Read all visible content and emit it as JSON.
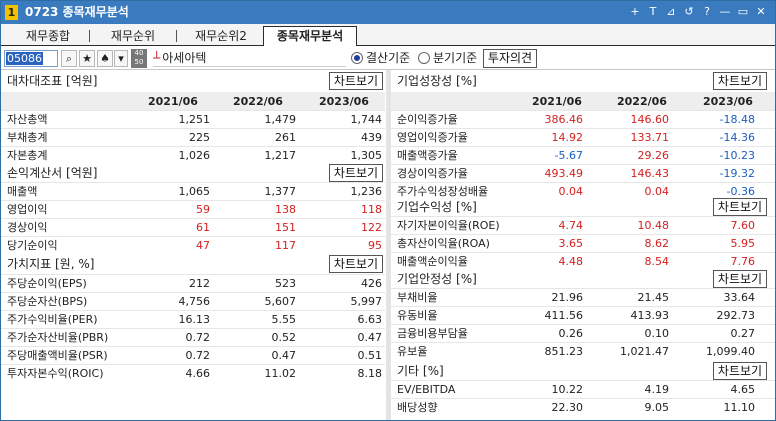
{
  "window": {
    "number": "1",
    "title": "0723 종목재무분석",
    "buttons": [
      "+",
      "T",
      "⊿",
      "↺",
      "?",
      "—",
      "▭",
      "✕"
    ]
  },
  "tabs": [
    "재무종합",
    "재무순위",
    "재무순위2",
    "종목재무분석"
  ],
  "active_tab": "종목재무분석",
  "toolbar": {
    "code": "05086",
    "qty_top": "40",
    "qty_bottom": "50",
    "stock_name": "아세아텍",
    "radio1": "결산기준",
    "radio2": "분기기준",
    "opinion_btn": "투자의견"
  },
  "chart_btn": "차트보기",
  "colors": {
    "positive": "#d42020",
    "negative": "#1a5fc0",
    "neutral": "#222222"
  },
  "left": {
    "years": [
      "2021/06",
      "2022/06",
      "2023/06"
    ],
    "balance": {
      "title": "대차대조표 [억원]",
      "rows": [
        {
          "label": "자산총액",
          "v": [
            "1,251",
            "1,479",
            "1,744"
          ],
          "c": [
            "n",
            "n",
            "n"
          ]
        },
        {
          "label": "부채총계",
          "v": [
            "225",
            "261",
            "439"
          ],
          "c": [
            "n",
            "n",
            "n"
          ]
        },
        {
          "label": "자본총계",
          "v": [
            "1,026",
            "1,217",
            "1,305"
          ],
          "c": [
            "n",
            "n",
            "n"
          ]
        }
      ]
    },
    "income": {
      "title": "손익계산서 [억원]",
      "rows": [
        {
          "label": "매출액",
          "v": [
            "1,065",
            "1,377",
            "1,236"
          ],
          "c": [
            "n",
            "n",
            "n"
          ]
        },
        {
          "label": "영업이익",
          "v": [
            "59",
            "138",
            "118"
          ],
          "c": [
            "p",
            "p",
            "p"
          ]
        },
        {
          "label": "경상이익",
          "v": [
            "61",
            "151",
            "122"
          ],
          "c": [
            "p",
            "p",
            "p"
          ]
        },
        {
          "label": "당기순이익",
          "v": [
            "47",
            "117",
            "95"
          ],
          "c": [
            "p",
            "p",
            "p"
          ]
        }
      ]
    },
    "value": {
      "title": "가치지표 [원, %]",
      "rows": [
        {
          "label": "주당순이익(EPS)",
          "v": [
            "212",
            "523",
            "426"
          ],
          "c": [
            "n",
            "n",
            "n"
          ]
        },
        {
          "label": "주당순자산(BPS)",
          "v": [
            "4,756",
            "5,607",
            "5,997"
          ],
          "c": [
            "n",
            "n",
            "n"
          ]
        },
        {
          "label": "주가수익비율(PER)",
          "v": [
            "16.13",
            "5.55",
            "6.63"
          ],
          "c": [
            "n",
            "n",
            "n"
          ]
        },
        {
          "label": "주가순자산비율(PBR)",
          "v": [
            "0.72",
            "0.52",
            "0.47"
          ],
          "c": [
            "n",
            "n",
            "n"
          ]
        },
        {
          "label": "주당매출액비율(PSR)",
          "v": [
            "0.72",
            "0.47",
            "0.51"
          ],
          "c": [
            "n",
            "n",
            "n"
          ]
        },
        {
          "label": "투자자본수익(ROIC)",
          "v": [
            "4.66",
            "11.02",
            "8.18"
          ],
          "c": [
            "n",
            "n",
            "n"
          ]
        }
      ]
    }
  },
  "right": {
    "years": [
      "2021/06",
      "2022/06",
      "2023/06"
    ],
    "growth": {
      "title": "기업성장성 [%]",
      "rows": [
        {
          "label": "순이익증가율",
          "v": [
            "386.46",
            "146.60",
            "-18.48"
          ],
          "c": [
            "p",
            "p",
            "m"
          ]
        },
        {
          "label": "영업이익증가율",
          "v": [
            "14.92",
            "133.71",
            "-14.36"
          ],
          "c": [
            "p",
            "p",
            "m"
          ]
        },
        {
          "label": "매출액증가율",
          "v": [
            "-5.67",
            "29.26",
            "-10.23"
          ],
          "c": [
            "m",
            "p",
            "m"
          ]
        },
        {
          "label": "경상이익증가율",
          "v": [
            "493.49",
            "146.43",
            "-19.32"
          ],
          "c": [
            "p",
            "p",
            "m"
          ]
        },
        {
          "label": "주가수익성장성배율",
          "v": [
            "0.04",
            "0.04",
            "-0.36"
          ],
          "c": [
            "p",
            "p",
            "m"
          ]
        }
      ]
    },
    "profit": {
      "title": "기업수익성 [%]",
      "rows": [
        {
          "label": "자기자본이익율(ROE)",
          "v": [
            "4.74",
            "10.48",
            "7.60"
          ],
          "c": [
            "p",
            "p",
            "p"
          ]
        },
        {
          "label": "총자산이익율(ROA)",
          "v": [
            "3.65",
            "8.62",
            "5.95"
          ],
          "c": [
            "p",
            "p",
            "p"
          ]
        },
        {
          "label": "매출액순이익율",
          "v": [
            "4.48",
            "8.54",
            "7.76"
          ],
          "c": [
            "p",
            "p",
            "p"
          ]
        }
      ]
    },
    "stability": {
      "title": "기업안정성 [%]",
      "rows": [
        {
          "label": "부채비율",
          "v": [
            "21.96",
            "21.45",
            "33.64"
          ],
          "c": [
            "n",
            "n",
            "n"
          ]
        },
        {
          "label": "유동비율",
          "v": [
            "411.56",
            "413.93",
            "292.73"
          ],
          "c": [
            "n",
            "n",
            "n"
          ]
        },
        {
          "label": "금융비용부담율",
          "v": [
            "0.26",
            "0.10",
            "0.27"
          ],
          "c": [
            "n",
            "n",
            "n"
          ]
        },
        {
          "label": "유보율",
          "v": [
            "851.23",
            "1,021.47",
            "1,099.40"
          ],
          "c": [
            "n",
            "n",
            "n"
          ]
        }
      ]
    },
    "etc": {
      "title": "기타 [%]",
      "rows": [
        {
          "label": "EV/EBITDA",
          "v": [
            "10.22",
            "4.19",
            "4.65"
          ],
          "c": [
            "n",
            "n",
            "n"
          ]
        },
        {
          "label": "배당성향",
          "v": [
            "22.30",
            "9.05",
            "11.10"
          ],
          "c": [
            "n",
            "n",
            "n"
          ]
        }
      ]
    }
  }
}
